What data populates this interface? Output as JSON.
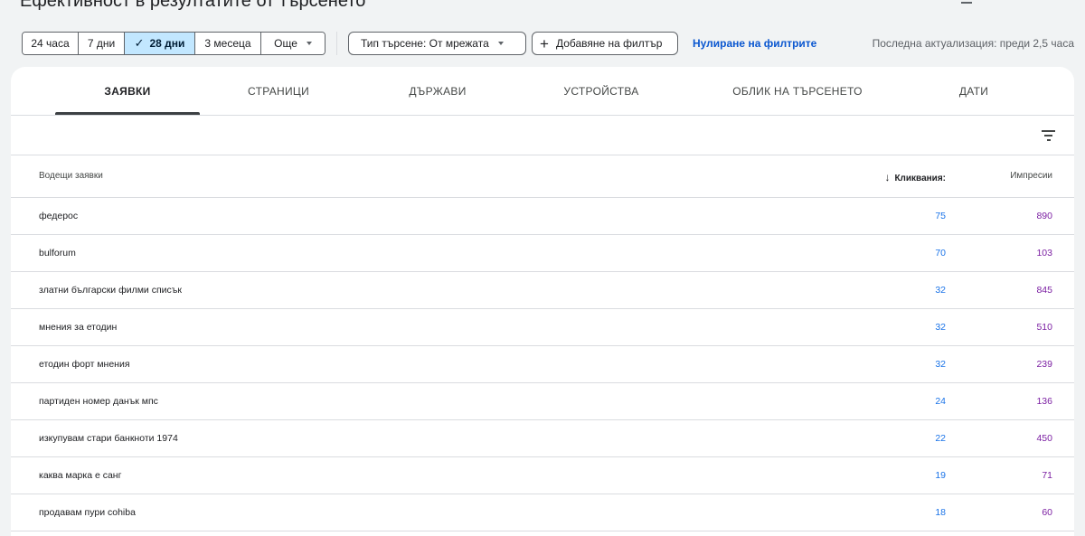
{
  "header": {
    "title": "Ефективност в резултатите от търсенето"
  },
  "toolbar": {
    "date_ranges": [
      {
        "label": "24 часа",
        "selected": false
      },
      {
        "label": "7 дни",
        "selected": false
      },
      {
        "label": "28 дни",
        "selected": true
      },
      {
        "label": "3 месеца",
        "selected": false
      },
      {
        "label": "Още",
        "selected": false
      }
    ],
    "search_type_label": "Тип търсене: От мрежата",
    "add_filter_label": "Добавяне на филтър",
    "reset_filters_label": "Нулиране на филтрите",
    "last_update": "Последна актуализация: преди 2,5 часа"
  },
  "tabs": [
    {
      "label": "ЗАЯВКИ",
      "active": true
    },
    {
      "label": "СТРАНИЦИ",
      "active": false
    },
    {
      "label": "ДЪРЖАВИ",
      "active": false
    },
    {
      "label": "УСТРОЙСТВА",
      "active": false
    },
    {
      "label": "ОБЛИК НА ТЪРСЕНЕТО",
      "active": false
    },
    {
      "label": "ДАТИ",
      "active": false
    }
  ],
  "table": {
    "columns": {
      "query": "Водещи заявки",
      "clicks": "Кликвания:",
      "impressions": "Импресии"
    },
    "rows": [
      {
        "query": "федерос",
        "clicks": "75",
        "impressions": "890"
      },
      {
        "query": "bulforum",
        "clicks": "70",
        "impressions": "103"
      },
      {
        "query": "златни български филми списък",
        "clicks": "32",
        "impressions": "845"
      },
      {
        "query": "мнения за етодин",
        "clicks": "32",
        "impressions": "510"
      },
      {
        "query": "етодин форт мнения",
        "clicks": "32",
        "impressions": "239"
      },
      {
        "query": "партиден номер данък мпс",
        "clicks": "24",
        "impressions": "136"
      },
      {
        "query": "изкупувам стари банкноти 1974",
        "clicks": "22",
        "impressions": "450"
      },
      {
        "query": "каква марка е санг",
        "clicks": "19",
        "impressions": "71"
      },
      {
        "query": "продавам пури cohiba",
        "clicks": "18",
        "impressions": "60"
      }
    ]
  },
  "colors": {
    "accent": "#0b57d0",
    "selected_bg": "#c2e7ff",
    "clicks": "#1a73e8",
    "impressions": "#7b1fa2"
  },
  "icons": {
    "check": "check-icon",
    "chevron": "chevron-down-icon",
    "plus": "plus-icon",
    "sort": "arrow-down-icon",
    "filter": "filter-icon"
  }
}
